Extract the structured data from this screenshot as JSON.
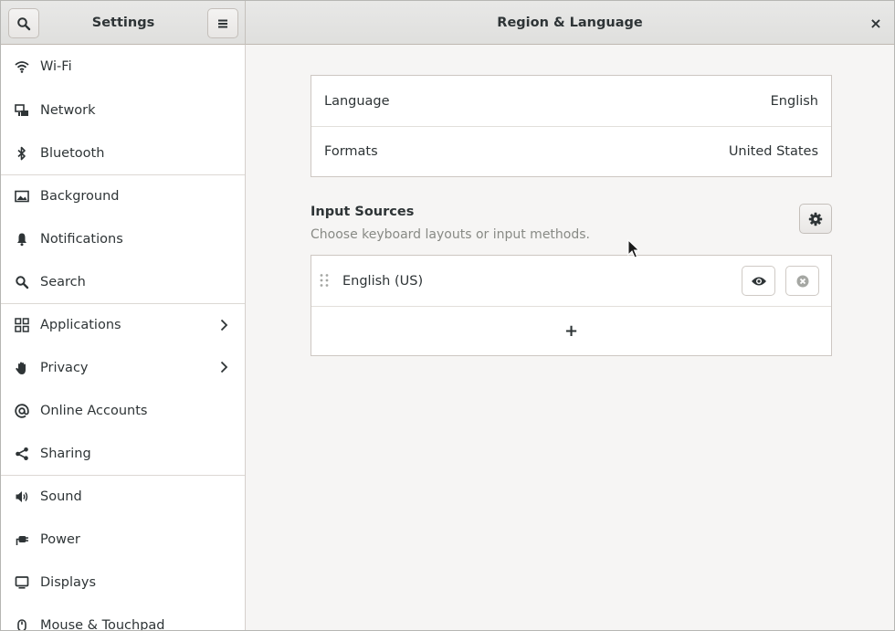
{
  "sidebar_header": {
    "title": "Settings",
    "search_icon": "search-icon",
    "menu_icon": "hamburger-menu-icon"
  },
  "main_header": {
    "title": "Region & Language",
    "close_label": "×"
  },
  "sidebar": {
    "items": [
      {
        "label": "Wi-Fi",
        "icon": "wifi-icon"
      },
      {
        "label": "Network",
        "icon": "network-icon"
      },
      {
        "label": "Bluetooth",
        "icon": "bluetooth-icon"
      },
      {
        "label": "Background",
        "icon": "background-icon"
      },
      {
        "label": "Notifications",
        "icon": "bell-icon"
      },
      {
        "label": "Search",
        "icon": "search-icon"
      },
      {
        "label": "Applications",
        "icon": "apps-grid-icon"
      },
      {
        "label": "Privacy",
        "icon": "hand-icon"
      },
      {
        "label": "Online Accounts",
        "icon": "at-sign-icon"
      },
      {
        "label": "Sharing",
        "icon": "share-icon"
      },
      {
        "label": "Sound",
        "icon": "speaker-icon"
      },
      {
        "label": "Power",
        "icon": "plug-icon"
      },
      {
        "label": "Displays",
        "icon": "display-icon"
      },
      {
        "label": "Mouse & Touchpad",
        "icon": "mouse-icon"
      }
    ]
  },
  "region": {
    "language_label": "Language",
    "language_value": "English",
    "formats_label": "Formats",
    "formats_value": "United States"
  },
  "input_sources": {
    "title": "Input Sources",
    "subtitle": "Choose keyboard layouts or input methods.",
    "sources": [
      {
        "label": "English (US)"
      }
    ],
    "add_label": "+"
  }
}
